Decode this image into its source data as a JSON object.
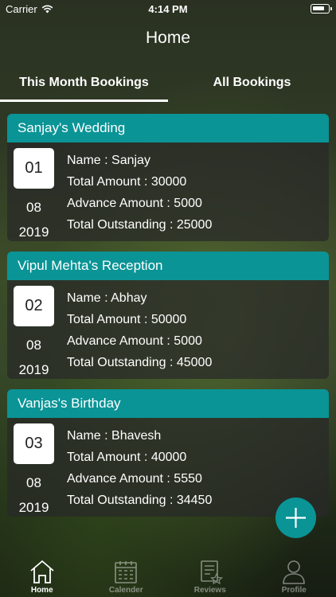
{
  "status_bar": {
    "carrier": "Carrier",
    "time": "4:14 PM"
  },
  "nav": {
    "title": "Home"
  },
  "tabs": [
    {
      "label": "This Month Bookings",
      "active": true
    },
    {
      "label": "All Bookings",
      "active": false
    }
  ],
  "bookings": [
    {
      "title": "Sanjay's Wedding",
      "day": "01",
      "month": "08",
      "year": "2019",
      "name": "Name :  Sanjay",
      "total": "Total Amount :  30000",
      "advance": "Advance Amount :  5000",
      "outstanding": "Total Outstanding : 25000"
    },
    {
      "title": "Vipul Mehta's Reception",
      "day": "02",
      "month": "08",
      "year": "2019",
      "name": "Name :  Abhay",
      "total": "Total Amount :  50000",
      "advance": "Advance Amount :  5000",
      "outstanding": "Total Outstanding : 45000"
    },
    {
      "title": "Vanjas's Birthday",
      "day": "03",
      "month": "08",
      "year": "2019",
      "name": "Name :  Bhavesh",
      "total": "Total Amount :  40000",
      "advance": "Advance Amount :  5550",
      "outstanding": "Total Outstanding : 34450"
    }
  ],
  "fab": {
    "icon": "plus-icon",
    "color": "#0a9496"
  },
  "tabbar": [
    {
      "label": "Home",
      "icon": "home-icon",
      "active": true
    },
    {
      "label": "Calender",
      "icon": "calendar-icon",
      "active": false
    },
    {
      "label": "Reviews",
      "icon": "reviews-icon",
      "active": false
    },
    {
      "label": "Profile",
      "icon": "profile-icon",
      "active": false
    }
  ],
  "colors": {
    "accent": "#0a9496",
    "card_body": "#282828"
  }
}
